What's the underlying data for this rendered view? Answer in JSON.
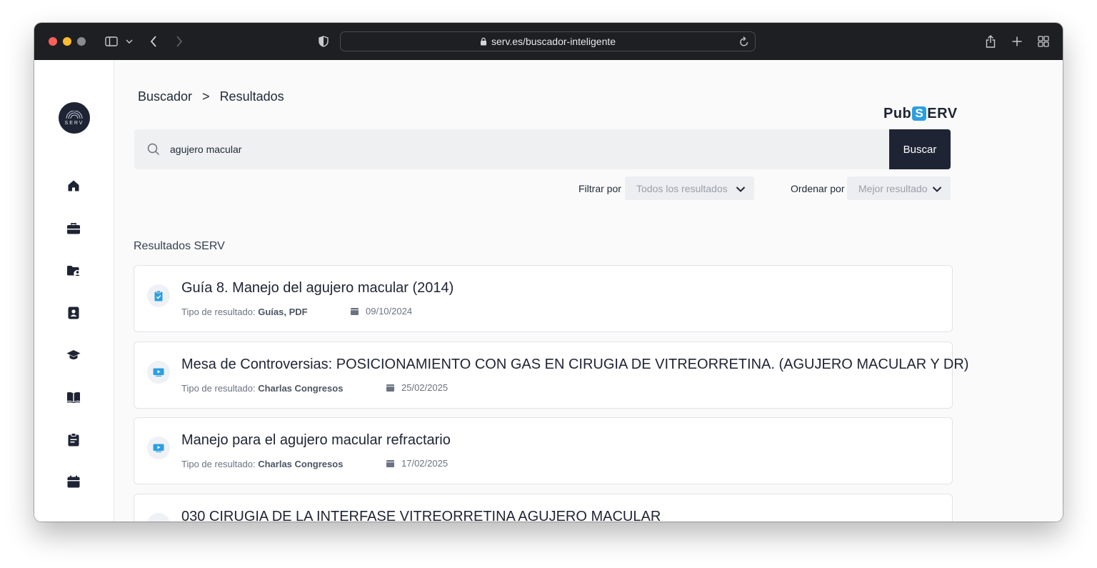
{
  "browser": {
    "url": "serv.es/buscador-inteligente"
  },
  "breadcrumb": {
    "root": "Buscador",
    "separator": ">",
    "current": "Resultados"
  },
  "brand": {
    "left": "Pub",
    "badge": "S",
    "right": "ERV"
  },
  "sidebar": {
    "logo_text": "SERV",
    "items": [
      {
        "icon": "home-icon"
      },
      {
        "icon": "briefcase-icon"
      },
      {
        "icon": "folder-user-icon"
      },
      {
        "icon": "contact-card-icon"
      },
      {
        "icon": "graduation-cap-icon"
      },
      {
        "icon": "open-book-icon"
      },
      {
        "icon": "clipboard-icon"
      },
      {
        "icon": "calendar-icon"
      }
    ]
  },
  "search": {
    "value": "agujero macular",
    "button_label": "Buscar"
  },
  "filters": {
    "filter_label": "Filtrar por",
    "filter_value": "Todos los resultados",
    "order_label": "Ordenar por",
    "order_value": "Mejor resultado"
  },
  "results": {
    "section_title": "Resultados SERV",
    "type_prefix": "Tipo de resultado:",
    "items": [
      {
        "title": "Guía 8. Manejo del agujero macular (2014)",
        "type": "Guías, PDF",
        "date": "09/10/2024",
        "icon": "document-icon"
      },
      {
        "title": "Mesa de Controversias: POSICIONAMIENTO CON GAS EN CIRUGIA DE VITREORRETINA. (AGUJERO MACULAR Y DR)",
        "type": "Charlas Congresos",
        "date": "25/02/2025",
        "icon": "video-icon"
      },
      {
        "title": "Manejo para el agujero macular refractario",
        "type": "Charlas Congresos",
        "date": "17/02/2025",
        "icon": "video-icon"
      },
      {
        "title": "030 CIRUGIA DE LA INTERFASE VITREORRETINA AGUJERO MACULAR"
      }
    ]
  },
  "colors": {
    "accent": "#2c9fe0",
    "dark": "#1f2434"
  }
}
